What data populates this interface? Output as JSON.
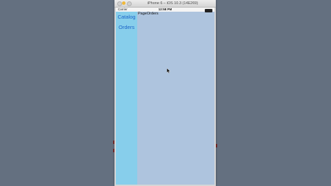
{
  "simulator": {
    "title": "iPhone 6 – iOS 10.3 (14E269)"
  },
  "status_bar": {
    "carrier": "Carrier",
    "time": "12:58 PM"
  },
  "sidebar": {
    "items": [
      {
        "label": "Catalog"
      },
      {
        "label": "Orders"
      }
    ]
  },
  "main": {
    "page_label": "PageOrders"
  },
  "colors": {
    "desktop_background": "#647080",
    "sidebar_background": "#87ceeb",
    "content_background": "#aec4de",
    "link_color": "#1a63c7"
  }
}
